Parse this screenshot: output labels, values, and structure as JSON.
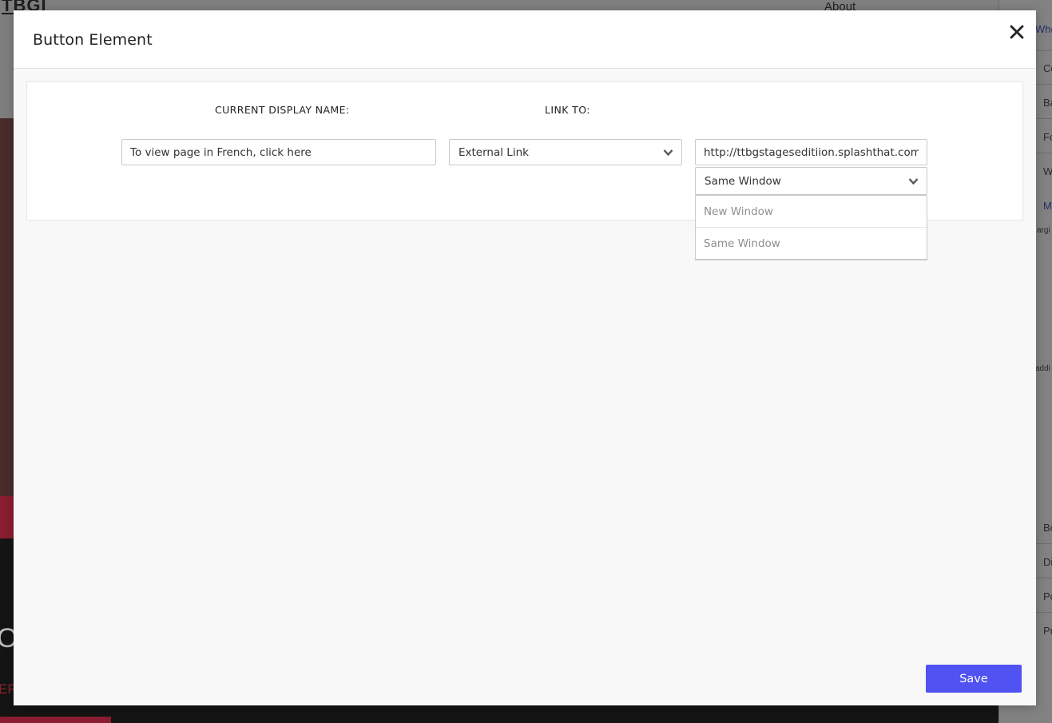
{
  "background": {
    "logo_text": "TBGI",
    "nav_about": "About",
    "hero_text_fragment": "O",
    "hero_subtext_fragment": "ER",
    "sidebar_fragments": [
      "Who",
      "Co",
      "Ba",
      "Fo",
      "W",
      "M",
      "argi",
      "addi",
      "Bo",
      "Di",
      "Po",
      "Pr"
    ]
  },
  "modal": {
    "title": "Button Element",
    "close_icon": "close-icon",
    "labels": {
      "display_name": "CURRENT DISPLAY NAME:",
      "link_to": "LINK TO:"
    },
    "display_name_value": "To view page in French, click here",
    "link_type": {
      "selected": "External Link",
      "icon": "chevron-down-icon"
    },
    "url_value": "http://ttbgstageseditiion.splashthat.com?stag",
    "window_target": {
      "selected": "Same Window",
      "options": [
        "New Window",
        "Same Window"
      ]
    },
    "save_label": "Save",
    "colors": {
      "primary": "#5052f2",
      "header_bg": "#ffffff",
      "body_bg": "#f8f8f8"
    }
  }
}
